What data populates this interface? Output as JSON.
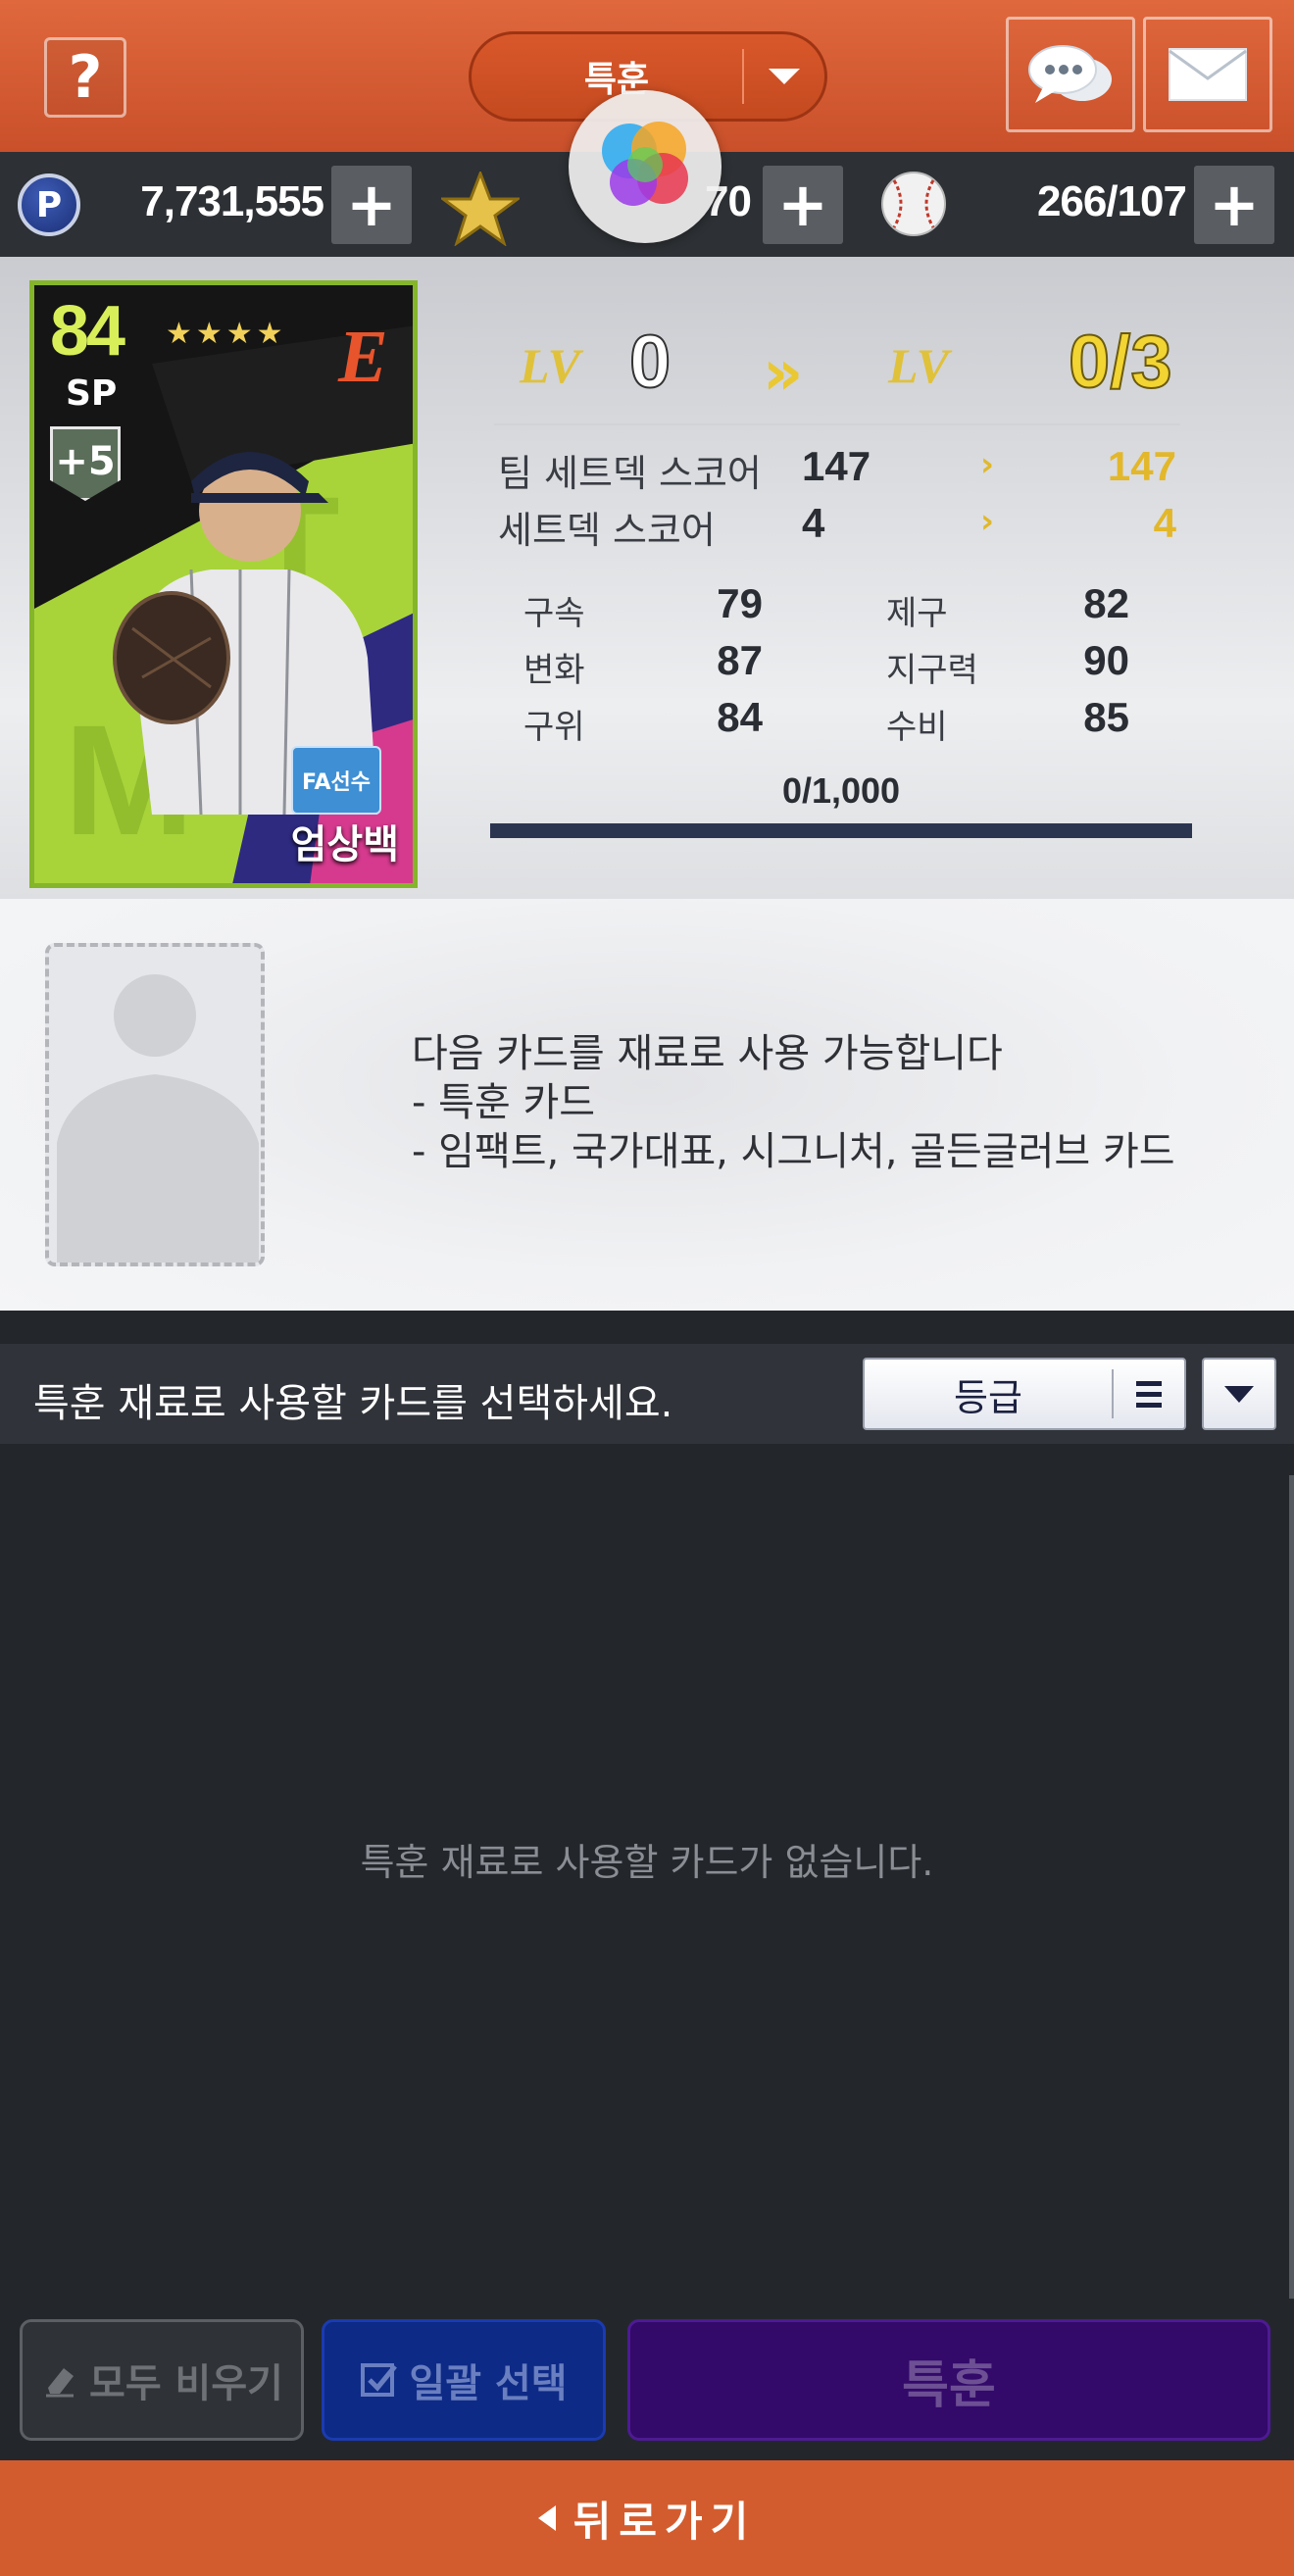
{
  "header": {
    "help_label": "?",
    "mode_label": "특훈"
  },
  "currencies": {
    "points": "7,731,555",
    "stars_partial": "70",
    "balls": "266/107",
    "point_icon_letter": "P",
    "plus": "+"
  },
  "card": {
    "overall": "84",
    "position": "SP",
    "stars": "★★★★",
    "enhance": "+5",
    "team_logo": "E",
    "badge": "FA선수",
    "name": "엄상백"
  },
  "level": {
    "lv_tag": "LV",
    "current": "0",
    "next": "0/3"
  },
  "scores": [
    {
      "label": "팀 세트덱 스코어",
      "current": "147",
      "next": "147"
    },
    {
      "label": "세트덱 스코어",
      "current": "4",
      "next": "4"
    }
  ],
  "stats": {
    "left": [
      {
        "label": "구속",
        "value": "79"
      },
      {
        "label": "변화",
        "value": "87"
      },
      {
        "label": "구위",
        "value": "84"
      }
    ],
    "right": [
      {
        "label": "제구",
        "value": "82"
      },
      {
        "label": "지구력",
        "value": "90"
      },
      {
        "label": "수비",
        "value": "85"
      }
    ]
  },
  "experience": {
    "text": "0/1,000",
    "fraction": 0
  },
  "material": {
    "line1": "다음 카드를 재료로 사용 가능합니다",
    "line2": "- 특훈 카드",
    "line3": "- 임팩트, 국가대표, 시그니처, 골든글러브 카드"
  },
  "select_bar": {
    "hint": "특훈 재료로 사용할 카드를 선택하세요.",
    "sort_label": "등급"
  },
  "list": {
    "empty_text": "특훈 재료로 사용할 카드가 없습니다."
  },
  "actions": {
    "clear": "모두 비우기",
    "bulk": "일괄 선택",
    "train": "특훈"
  },
  "footer": {
    "back": "뒤로가기"
  },
  "colors": {
    "header": "#d35c2e",
    "accent_gold": "#e3b72a",
    "train_button": "#33096a",
    "bulk_button": "#0d2a86"
  }
}
